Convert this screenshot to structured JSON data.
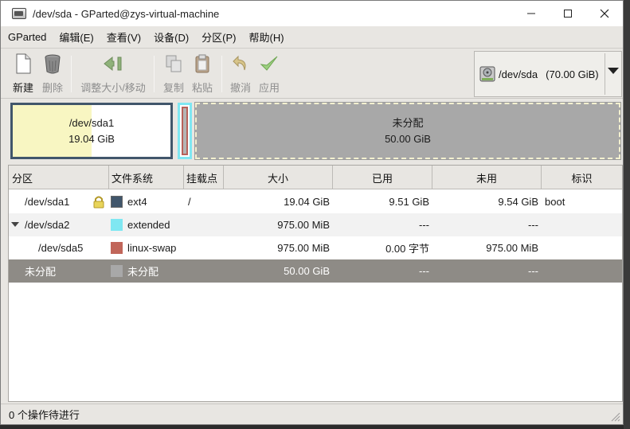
{
  "window": {
    "title": "/dev/sda - GParted@zys-virtual-machine",
    "minimize": "—",
    "maximize": "☐",
    "close": "✕"
  },
  "menu": [
    "GParted",
    "编辑(E)",
    "查看(V)",
    "设备(D)",
    "分区(P)",
    "帮助(H)"
  ],
  "toolbar": {
    "new": "新建",
    "delete": "删除",
    "resize": "调整大小/移动",
    "copy": "复制",
    "paste": "粘贴",
    "undo": "撤消",
    "apply": "应用"
  },
  "device": {
    "name": "/dev/sda",
    "size": "(70.00 GiB)"
  },
  "diskmap": {
    "sda1_name": "/dev/sda1",
    "sda1_size": "19.04 GiB",
    "sda1_used_fraction": 0.5,
    "unalloc_name": "未分配",
    "unalloc_size": "50.00 GiB"
  },
  "table": {
    "headers": [
      "分区",
      "文件系统",
      "挂载点",
      "大小",
      "已用",
      "未用",
      "标识"
    ],
    "rows": [
      {
        "partition": "/dev/sda1",
        "fs": "ext4",
        "fs_color": "#41566b",
        "mount": "/",
        "size": "19.04 GiB",
        "used": "9.51 GiB",
        "unused": "9.54 GiB",
        "flags": "boot"
      },
      {
        "partition": "/dev/sda2",
        "fs": "extended",
        "fs_color": "#7fe7f2",
        "mount": "",
        "size": "975.00 MiB",
        "used": "---",
        "unused": "---",
        "flags": ""
      },
      {
        "partition": "/dev/sda5",
        "fs": "linux-swap",
        "fs_color": "#c1665a",
        "mount": "",
        "size": "975.00 MiB",
        "used": "0.00 字节",
        "unused": "975.00 MiB",
        "flags": ""
      },
      {
        "partition": "未分配",
        "fs": "未分配",
        "fs_color": "#a8a8a8",
        "mount": "",
        "size": "50.00 GiB",
        "used": "---",
        "unused": "---",
        "flags": ""
      }
    ]
  },
  "status": "0 个操作待进行"
}
